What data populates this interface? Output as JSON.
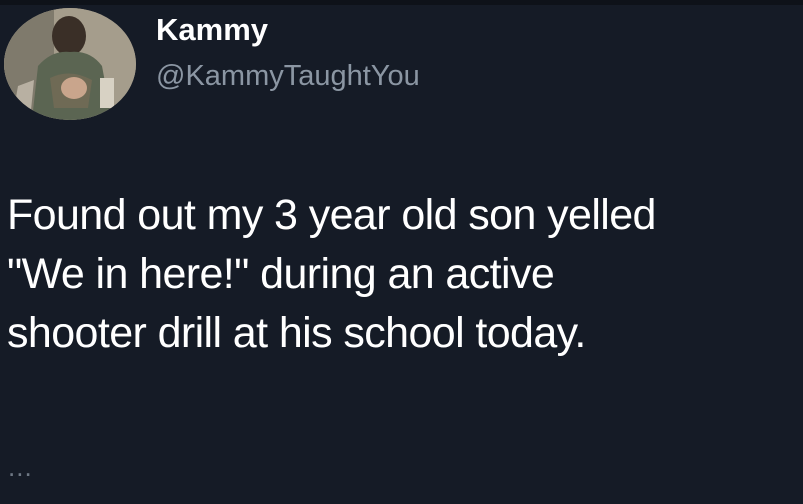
{
  "user": {
    "display_name": "Kammy",
    "handle": "@KammyTaughtYou",
    "avatar_icon": "profile-photo"
  },
  "tweet": {
    "lines": [
      "Found out my 3 year old son yelled",
      "\"We in here!\" during an active",
      "shooter drill at his school today."
    ],
    "more_indicator": "..."
  },
  "colors": {
    "background": "#151b26",
    "text": "#ffffff",
    "handle": "#8b96a3"
  }
}
